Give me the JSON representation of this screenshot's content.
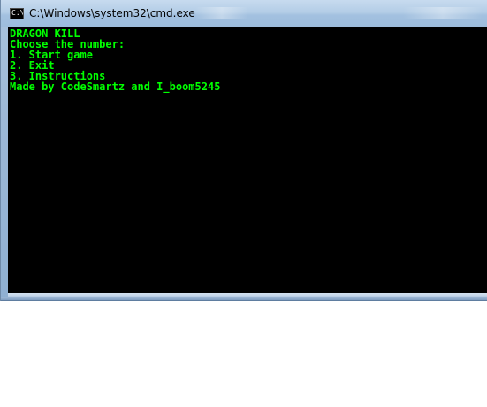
{
  "window": {
    "title": "C:\\Windows\\system32\\cmd.exe",
    "icon_label": "C:\\"
  },
  "console": {
    "text_color": "#00ff00",
    "background": "#000000",
    "lines": [
      "DRAGON KILL",
      "Choose the number:",
      "1. Start game",
      "2. Exit",
      "3. Instructions",
      "Made by CodeSmartz and I_boom5245"
    ]
  }
}
